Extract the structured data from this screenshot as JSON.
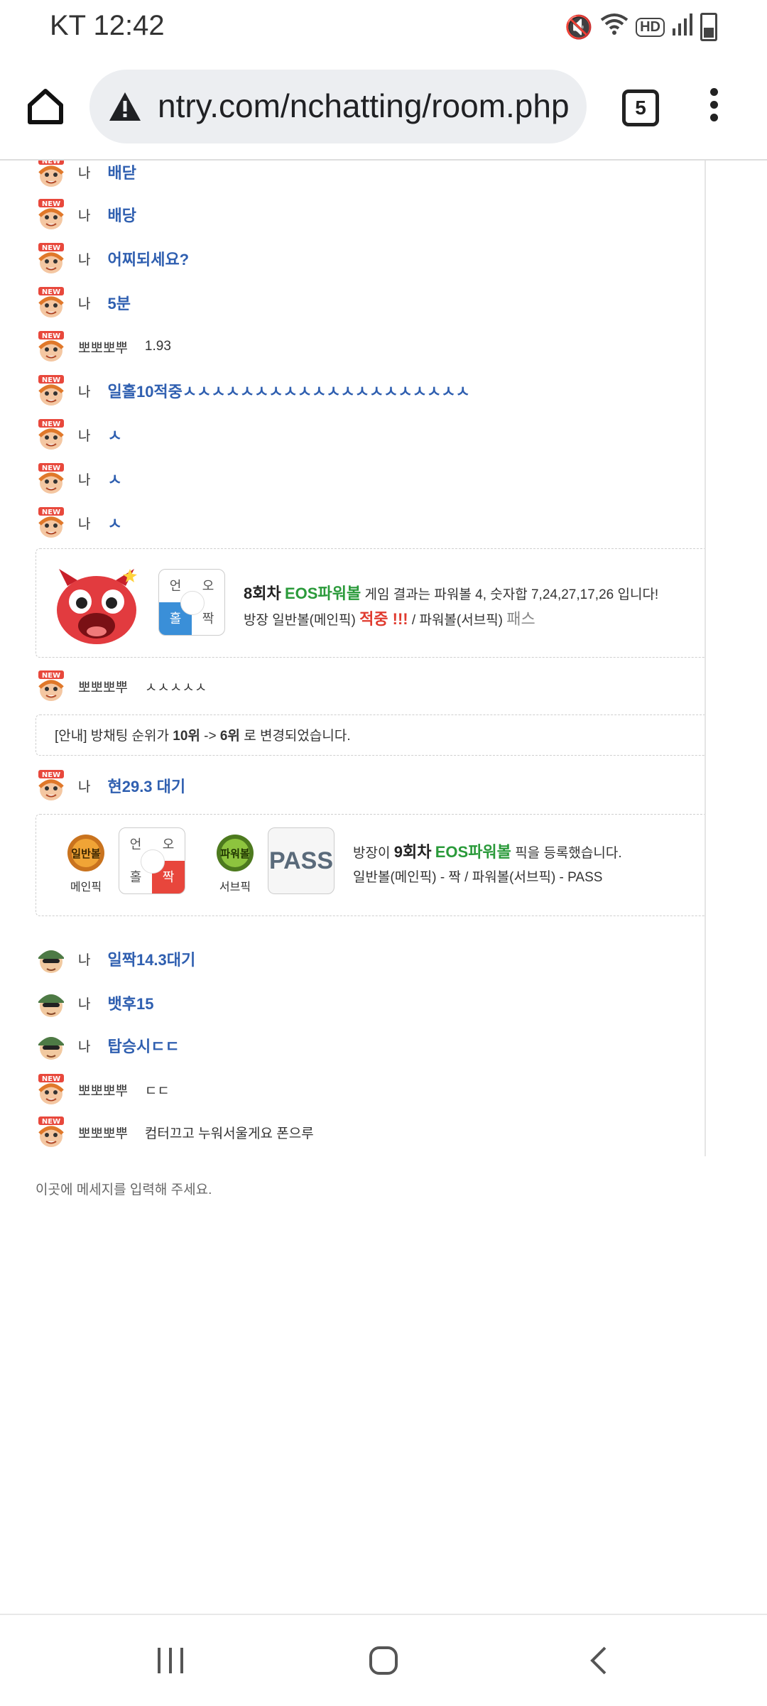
{
  "status_bar": {
    "time": "KT 12:42",
    "hd_label": "HD"
  },
  "browser": {
    "url": "ntry.com/nchatting/room.php",
    "tab_count": "5"
  },
  "chat_messages": [
    {
      "nick": "나",
      "text": "배닫",
      "style": "blue"
    },
    {
      "nick": "나",
      "text": "배당",
      "style": "blue"
    },
    {
      "nick": "나",
      "text": "어찌되세요?",
      "style": "blue"
    },
    {
      "nick": "나",
      "text": "5분",
      "style": "blue"
    },
    {
      "nick": "뽀뽀뽀뿌",
      "text": "1.93",
      "style": "plain"
    },
    {
      "nick": "나",
      "text": "일홀10적중ㅅㅅㅅㅅㅅㅅㅅㅅㅅㅅㅅㅅㅅㅅㅅㅅㅅㅅㅅㅅ",
      "style": "blue"
    },
    {
      "nick": "나",
      "text": "ㅅ",
      "style": "blue"
    },
    {
      "nick": "나",
      "text": "ㅅ",
      "style": "blue"
    },
    {
      "nick": "나",
      "text": "ㅅ",
      "style": "blue"
    }
  ],
  "result_box": {
    "round": "8회차",
    "game": "EOS파워볼",
    "line1_rest": " 게임 결과는 파워볼 4, 숫자합 7,24,27,17,26 입니다!",
    "line2_a": "방장 일반볼(메인픽) ",
    "hit": "적중 !!!",
    "line2_b": " / 파워볼(서브픽) ",
    "pass": "패스",
    "grid": {
      "tl": "언",
      "tr": "오",
      "bl": "홀",
      "br": "짝"
    }
  },
  "msg_after_result": {
    "nick": "뽀뽀뽀뿌",
    "text": "ㅅㅅㅅㅅㅅ"
  },
  "notice": {
    "prefix": "[안내] 방채팅 순위가 ",
    "from": "10위",
    "arrow": " -> ",
    "to": "6위",
    "suffix": " 로 변경되었습니다."
  },
  "msg_wait": {
    "nick": "나",
    "text": "현29.3 대기"
  },
  "pick_box": {
    "main_badge": "일반볼",
    "main_label": "메인픽",
    "sub_badge": "파워볼",
    "sub_label": "서브픽",
    "pass_text": "PASS",
    "grid": {
      "tl": "언",
      "tr": "오",
      "bl": "홀",
      "br": "짝"
    },
    "line1_a": "방장이 ",
    "round": "9회차",
    "game": "EOS파워볼",
    "line1_b": " 픽을 등록했습니다.",
    "line2": "일반볼(메인픽) - 짝 / 파워볼(서브픽) - PASS"
  },
  "chat_messages_2": [
    {
      "nick": "나",
      "text": "일짝14.3대기",
      "style": "blue",
      "avatar": "soldier"
    },
    {
      "nick": "나",
      "text": "뱃후15",
      "style": "blue",
      "avatar": "soldier"
    },
    {
      "nick": "나",
      "text": "탑승시ㄷㄷ",
      "style": "blue",
      "avatar": "soldier"
    },
    {
      "nick": "뽀뽀뽀뿌",
      "text": "ㄷㄷ",
      "style": "plain",
      "avatar": "new"
    },
    {
      "nick": "뽀뽀뽀뿌",
      "text": "컴터끄고 누워서울게요 폰으루",
      "style": "plain",
      "avatar": "new"
    }
  ],
  "input": {
    "placeholder": "이곳에 메세지를 입력해 주세요."
  },
  "colors": {
    "link_blue": "#2f5fb0",
    "eos_green": "#2a9a3a",
    "hit_red": "#e03a2e",
    "odd_blue": "#3a8fd8",
    "even_red": "#e8463c"
  }
}
